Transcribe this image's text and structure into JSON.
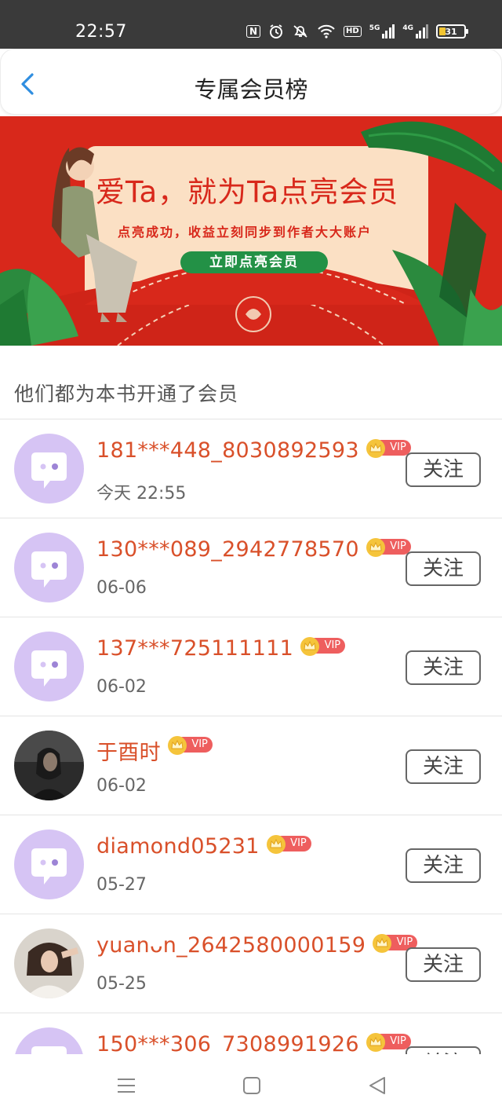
{
  "status_bar": {
    "time": "22:57",
    "icons": [
      "nfc-icon",
      "alarm-icon",
      "mute-icon",
      "wifi-icon",
      "hd-icon",
      "signal-5g-icon",
      "signal-4g-icon",
      "battery-icon"
    ],
    "hd_label": "HD",
    "net1": "5G",
    "net2": "4G",
    "battery_level": "31"
  },
  "nav": {
    "title": "专属会员榜"
  },
  "banner": {
    "headline": "爱Ta，就为Ta点亮会员",
    "subline": "点亮成功，收益立刻同步到作者大大账户",
    "cta": "立即点亮会员"
  },
  "section": {
    "title": "他们都为本书开通了会员"
  },
  "members": [
    {
      "name": "181***448_8030892593",
      "date": "今天 22:55",
      "vip": "VIP",
      "follow": "关注",
      "avatar": "default"
    },
    {
      "name": "130***089_2942778570",
      "date": "06-06",
      "vip": "VIP",
      "follow": "关注",
      "avatar": "default"
    },
    {
      "name": "137***725111111",
      "date": "06-02",
      "vip": "VIP",
      "follow": "关注",
      "avatar": "default"
    },
    {
      "name": "于酉时",
      "date": "06-02",
      "vip": "VIP",
      "follow": "关注",
      "avatar": "photo-dark"
    },
    {
      "name": "diamond05231",
      "date": "05-27",
      "vip": "VIP",
      "follow": "关注",
      "avatar": "default"
    },
    {
      "name": "yuanᴗn_2642580000159",
      "date": "05-25",
      "vip": "VIP",
      "follow": "关注",
      "avatar": "photo-light"
    },
    {
      "name": "150***306_7308991926",
      "date": "",
      "vip": "VIP",
      "follow": "关注",
      "avatar": "default"
    }
  ],
  "colors": {
    "accent_red": "#d9502a",
    "vip_pill": "#ee5e5e",
    "banner_red": "#d8281b",
    "avatar_lilac": "#d6c4f4",
    "back_blue": "#2f8ee0"
  }
}
